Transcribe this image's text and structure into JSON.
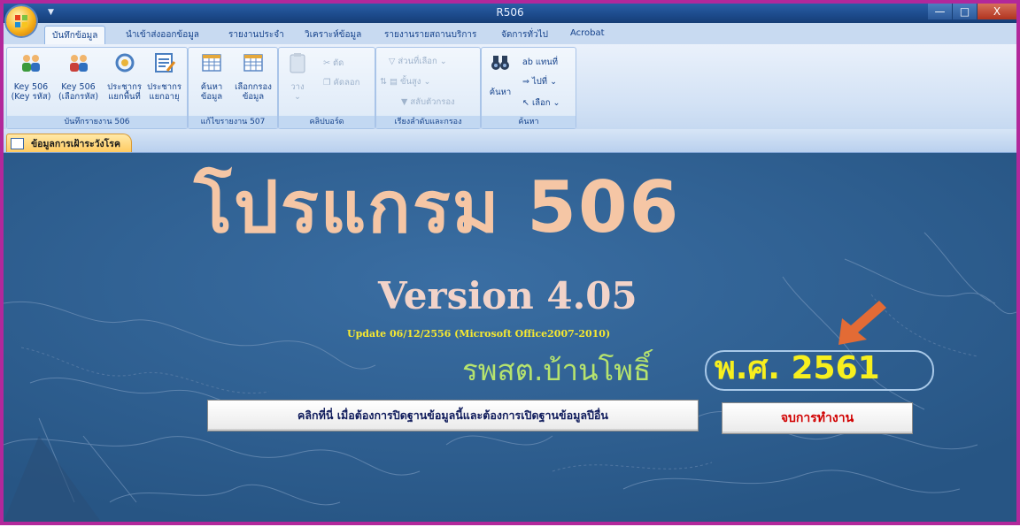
{
  "window": {
    "title": "R506",
    "controls": [
      "—",
      "□",
      "X"
    ]
  },
  "ribbon": {
    "tabs": [
      {
        "label": "บันทึกข้อมูล",
        "active": true
      },
      {
        "label": "นำเข้าส่งออกข้อมูล"
      },
      {
        "label": "รายงานประจำ"
      },
      {
        "label": "วิเคราะห์ข้อมูล"
      },
      {
        "label": "รายงานรายสถานบริการ"
      },
      {
        "label": "จัดการทั่วไป"
      },
      {
        "label": "Acrobat"
      }
    ],
    "groups": {
      "report506": {
        "label": "บันทึกรายงาน 506",
        "buttons": [
          {
            "line1": "Key 506",
            "line2": "(Key รหัส)",
            "icon": "people-icon"
          },
          {
            "line1": "Key 506",
            "line2": "(เลือกรหัส)",
            "icon": "people-icon"
          },
          {
            "line1": "ประชากร",
            "line2": "แยกพื้นที่",
            "icon": "population-area-icon"
          },
          {
            "line1": "ประชากร",
            "line2": "แยกอายุ",
            "icon": "form-edit-icon"
          }
        ]
      },
      "edit507": {
        "label": "แก้ไขรายงาน 507",
        "buttons": [
          {
            "line1": "ค้นหา",
            "line2": "ข้อมูล",
            "icon": "datasheet-icon"
          },
          {
            "line1": "เลือกกรอง",
            "line2": "ข้อมูล",
            "icon": "datasheet-icon"
          }
        ]
      },
      "clipboard": {
        "label": "คลิปบอร์ด",
        "paste": "วาง",
        "cut": "ตัด",
        "copy": "คัดลอก"
      },
      "sortfilter": {
        "label": "เรียงลำดับและกรอง",
        "selection": "ส่วนที่เลือก",
        "advanced": "ขั้นสูง",
        "toggle": "สลับตัวกรอง"
      },
      "find": {
        "label": "ค้นหา",
        "find": "ค้นหา",
        "replace": "แทนที่",
        "goto": "ไปที่",
        "select": "เลือก"
      }
    }
  },
  "object_tab": {
    "label": "ข้อมูลการเฝ้าระวังโรค"
  },
  "main": {
    "title": "โปรแกรม 506",
    "version": "Version 4.05",
    "update": "Update  06/12/2556  (Microsoft Office2007-2010)",
    "hospital": "รพสต.บ้านโพธิ์",
    "year": "พ.ศ. 2561",
    "open_button": "คลิกที่นี่ เมื่อต้องการปิดฐานข้อมูลนี้และต้องการเปิดฐานข้อมูลปีอื่น",
    "exit_button": "จบการทำงาน"
  },
  "colors": {
    "frame": "#b2289b",
    "form_bg": "#2f5f91",
    "title_text": "#f5c6a5",
    "year_text": "#f7ef1e",
    "hospital_text": "#b6e36e",
    "exit_text": "#d10000",
    "arrow": "#e36b35"
  }
}
